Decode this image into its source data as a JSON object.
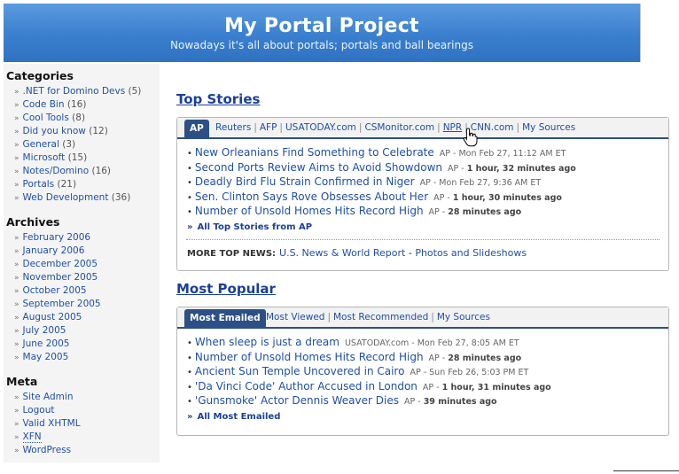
{
  "header": {
    "title": "My Portal Project",
    "tagline": "Nowadays it's all about portals; portals and ball bearings"
  },
  "sidebar": {
    "categories": {
      "heading": "Categories",
      "items": [
        {
          "label": ".NET for Domino Devs",
          "count": "(5)"
        },
        {
          "label": "Code Bin",
          "count": "(16)"
        },
        {
          "label": "Cool Tools",
          "count": "(8)"
        },
        {
          "label": "Did you know",
          "count": "(12)"
        },
        {
          "label": "General",
          "count": "(3)"
        },
        {
          "label": "Microsoft",
          "count": "(15)"
        },
        {
          "label": "Notes/Domino",
          "count": "(16)"
        },
        {
          "label": "Portals",
          "count": "(21)"
        },
        {
          "label": "Web Development",
          "count": "(36)"
        }
      ]
    },
    "archives": {
      "heading": "Archives",
      "items": [
        "February 2006",
        "January 2006",
        "December 2005",
        "November 2005",
        "October 2005",
        "September 2005",
        "August 2005",
        "July 2005",
        "June 2005",
        "May 2005"
      ]
    },
    "meta": {
      "heading": "Meta",
      "items": [
        "Site Admin",
        "Logout",
        "Valid XHTML",
        "XFN",
        "WordPress"
      ]
    }
  },
  "top_stories": {
    "title": "Top Stories",
    "active_tab": "AP",
    "tabs": [
      "Reuters",
      "AFP",
      "USATODAY.com",
      "CSMonitor.com",
      "NPR",
      "CNN.com",
      "My Sources"
    ],
    "stories": [
      {
        "headline": "New Orleanians Find Something to Celebrate",
        "source": "AP - Mon Feb 27, 11:12 AM ET",
        "ago": ""
      },
      {
        "headline": "Second Ports Review Aims to Avoid Showdown",
        "source": "AP - ",
        "ago": "1 hour, 32 minutes ago"
      },
      {
        "headline": "Deadly Bird Flu Strain Confirmed in Niger",
        "source": "AP - Mon Feb 27, 9:36 AM ET",
        "ago": ""
      },
      {
        "headline": "Sen. Clinton Says Rove Obsesses About Her",
        "source": "AP - ",
        "ago": "1 hour, 30 minutes ago"
      },
      {
        "headline": "Number of Unsold Homes Hits Record High",
        "source": "AP - ",
        "ago": "28 minutes ago"
      }
    ],
    "all_link": "All Top Stories from AP",
    "more_label": "MORE TOP NEWS:",
    "more_link1": "U.S. News & World Report",
    "more_sep": " - ",
    "more_link2": "Photos and Slideshows"
  },
  "most_popular": {
    "title": "Most Popular",
    "active_tab": "Most Emailed",
    "tabs": [
      "Most Viewed",
      "Most Recommended",
      "My Sources"
    ],
    "stories": [
      {
        "headline": "When sleep is just a dream",
        "source": "USATODAY.com - Mon Feb 27, 8:05 AM ET",
        "ago": ""
      },
      {
        "headline": "Number of Unsold Homes Hits Record High",
        "source": "AP - ",
        "ago": "28 minutes ago"
      },
      {
        "headline": "Ancient Sun Temple Uncovered in Cairo",
        "source": "AP - Sun Feb 26, 5:03 PM ET",
        "ago": ""
      },
      {
        "headline": "'Da Vinci Code' Author Accused in London",
        "source": "AP - ",
        "ago": "1 hour, 31 minutes ago"
      },
      {
        "headline": "'Gunsmoke' Actor Dennis Weaver Dies",
        "source": "AP - ",
        "ago": "39 minutes ago"
      }
    ],
    "all_link": "All Most Emailed"
  },
  "colors": {
    "header_blue": "#3a7fce",
    "tab_navy": "#2c4f86",
    "link_blue": "#1f4fa6"
  }
}
